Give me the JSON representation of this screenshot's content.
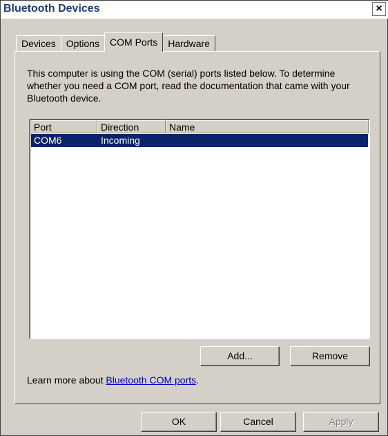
{
  "window": {
    "title": "Bluetooth Devices",
    "close_label": "×"
  },
  "tabs": [
    {
      "label": "Devices"
    },
    {
      "label": "Options"
    },
    {
      "label": "COM Ports"
    },
    {
      "label": "Hardware"
    }
  ],
  "active_tab": "COM Ports",
  "description": "This computer is using the COM (serial) ports listed below. To determine whether you need a COM port, read the documentation that came with your Bluetooth device.",
  "list": {
    "columns": [
      "Port",
      "Direction",
      "Name"
    ],
    "rows": [
      {
        "port": "COM6",
        "direction": "Incoming",
        "name": "",
        "selected": true
      }
    ]
  },
  "buttons": {
    "add": "Add...",
    "remove": "Remove",
    "ok": "OK",
    "cancel": "Cancel",
    "apply": "Apply"
  },
  "learn_more": {
    "prefix": "Learn more about ",
    "link": "Bluetooth COM ports",
    "suffix": "."
  },
  "colors": {
    "title_text": "#1c3b78",
    "selection": "#0a246a",
    "dialog_face": "#d4d0c8",
    "link": "#0000cc"
  }
}
